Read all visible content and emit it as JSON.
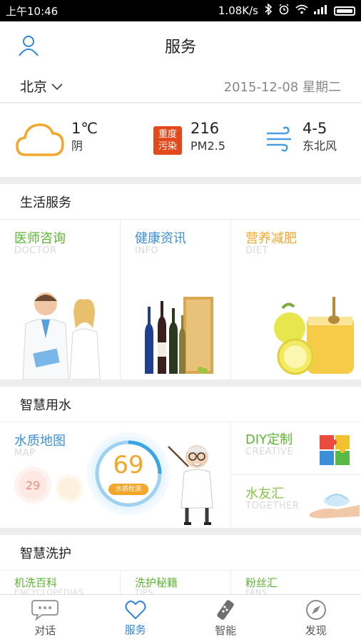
{
  "status_bar": {
    "time": "上午10:46",
    "speed": "1.08K/s"
  },
  "header": {
    "title": "服务"
  },
  "location": {
    "city": "北京",
    "date": "2015-12-08 星期二"
  },
  "weather": {
    "temp": "1℃",
    "condition": "阴",
    "pollution_badge": "重度污染",
    "pollution_badge_line1": "重度",
    "pollution_badge_line2": "污染",
    "aqi": "216",
    "aqi_label": "PM2.5",
    "wind_level": "4-5",
    "wind_dir": "东北风"
  },
  "life_services": {
    "title": "生活服务",
    "items": [
      {
        "cn": "医师咨询",
        "en": "DOCTOR",
        "color": "#5cb531"
      },
      {
        "cn": "健康资讯",
        "en": "INFO",
        "color": "#3d8fd6"
      },
      {
        "cn": "营养减肥",
        "en": "DIET",
        "color": "#f2a72b"
      }
    ]
  },
  "smart_water": {
    "title": "智慧用水",
    "map": {
      "cn": "水质地图",
      "en": "MAP",
      "score": "69",
      "score_label": "水质检测",
      "bubble_a": "29"
    },
    "diy": {
      "cn": "DIY定制",
      "en": "CREATIVE"
    },
    "together": {
      "cn": "水友汇",
      "en": "TOGETHER"
    }
  },
  "smart_wash": {
    "title": "智慧洗护",
    "items": [
      {
        "cn": "机洗百科",
        "en": "ENCYCLOPEDIAS"
      },
      {
        "cn": "洗护秘籍",
        "en": "TIPS"
      },
      {
        "cn": "粉丝汇",
        "en": "FANS"
      }
    ]
  },
  "nav": {
    "items": [
      {
        "label": "对话",
        "icon": "chat-bubble-icon"
      },
      {
        "label": "服务",
        "icon": "heart-icon"
      },
      {
        "label": "智能",
        "icon": "remote-control-icon"
      },
      {
        "label": "发现",
        "icon": "compass-icon"
      }
    ]
  },
  "colors": {
    "accent": "#2f86d6",
    "green": "#5cb531",
    "orange": "#f2a72b",
    "pollution": "#e24a1c"
  }
}
